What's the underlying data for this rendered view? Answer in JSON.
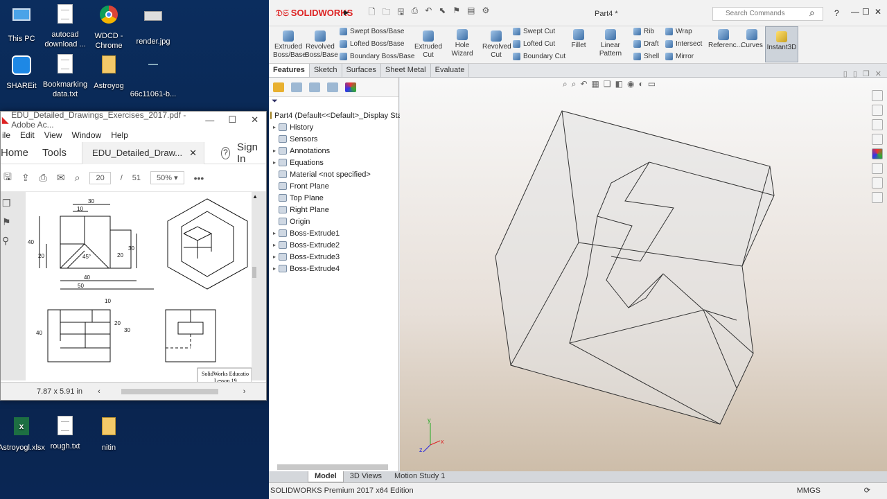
{
  "desktop": {
    "icons": [
      {
        "label": "This PC",
        "type": "pc"
      },
      {
        "label": "autocad download ...",
        "type": "doc"
      },
      {
        "label": "WDCD - Chrome",
        "type": "chrome"
      },
      {
        "label": "render.jpg",
        "type": "img"
      },
      {
        "label": "SHAREit",
        "type": "shareit"
      },
      {
        "label": "Bookmarking data.txt",
        "type": "doc"
      },
      {
        "label": "Astroyog",
        "type": "zip"
      },
      {
        "label": "66c11061-b...",
        "type": "file"
      },
      {
        "label": "Astroyogl.xlsx",
        "type": "xlsx"
      },
      {
        "label": "rough.txt",
        "type": "doc"
      },
      {
        "label": "nitin",
        "type": "zip"
      }
    ]
  },
  "acrobat": {
    "title": "EDU_Detailed_Drawings_Exercises_2017.pdf - Adobe Ac...",
    "menu": [
      "ile",
      "Edit",
      "View",
      "Window",
      "Help"
    ],
    "tabs": {
      "home": "Home",
      "tools": "Tools",
      "doc": "EDU_Detailed_Draw...",
      "signin": "Sign In"
    },
    "page_current": "20",
    "page_sep": "/",
    "page_total": "51",
    "zoom": "50%",
    "page_size": "7.87 x 5.91 in",
    "caption_line1": "SolidWorks Educatio",
    "caption_line2": "Lesson 19",
    "dims": {
      "d30": "30",
      "d10": "10",
      "d40a": "40",
      "d20a": "20",
      "d45": "45°",
      "d30b": "30",
      "d20b": "20",
      "d40b": "40",
      "d50": "50",
      "d10b": "10",
      "d40c": "40",
      "d20c": "20",
      "d30c": "30"
    }
  },
  "sw": {
    "logo": "SOLIDWORKS",
    "doc_title": "Part4 *",
    "search_placeholder": "Search Commands",
    "ribbon": {
      "extruded_boss": "Extruded Boss/Base",
      "revolved_boss": "Revolved Boss/Base",
      "swept_boss": "Swept Boss/Base",
      "lofted_boss": "Lofted Boss/Base",
      "boundary_boss": "Boundary Boss/Base",
      "extruded_cut": "Extruded Cut",
      "hole_wizard": "Hole Wizard",
      "revolved_cut": "Revolved Cut",
      "swept_cut": "Swept Cut",
      "lofted_cut": "Lofted Cut",
      "boundary_cut": "Boundary Cut",
      "fillet": "Fillet",
      "linear_pattern": "Linear Pattern",
      "rib": "Rib",
      "draft": "Draft",
      "shell": "Shell",
      "wrap": "Wrap",
      "intersect": "Intersect",
      "mirror": "Mirror",
      "reference": "Referenc...",
      "curves": "Curves",
      "instant3d": "Instant3D"
    },
    "cm_tabs": [
      "Features",
      "Sketch",
      "Surfaces",
      "Sheet Metal",
      "Evaluate"
    ],
    "tree_root": "Part4  (Default<<Default>_Display Sta",
    "tree": [
      {
        "label": "History",
        "exp": true
      },
      {
        "label": "Sensors",
        "exp": false
      },
      {
        "label": "Annotations",
        "exp": true
      },
      {
        "label": "Equations",
        "exp": true
      },
      {
        "label": "Material <not specified>",
        "exp": false
      },
      {
        "label": "Front Plane",
        "exp": false
      },
      {
        "label": "Top Plane",
        "exp": false
      },
      {
        "label": "Right Plane",
        "exp": false
      },
      {
        "label": "Origin",
        "exp": false
      },
      {
        "label": "Boss-Extrude1",
        "exp": true
      },
      {
        "label": "Boss-Extrude2",
        "exp": true
      },
      {
        "label": "Boss-Extrude3",
        "exp": true
      },
      {
        "label": "Boss-Extrude4",
        "exp": true
      }
    ],
    "bottom_tabs": [
      "Model",
      "3D Views",
      "Motion Study 1"
    ],
    "status": "SOLIDWORKS Premium 2017 x64 Edition",
    "units": "MMGS",
    "triad": {
      "x": "x",
      "y": "y",
      "z": "z"
    }
  }
}
